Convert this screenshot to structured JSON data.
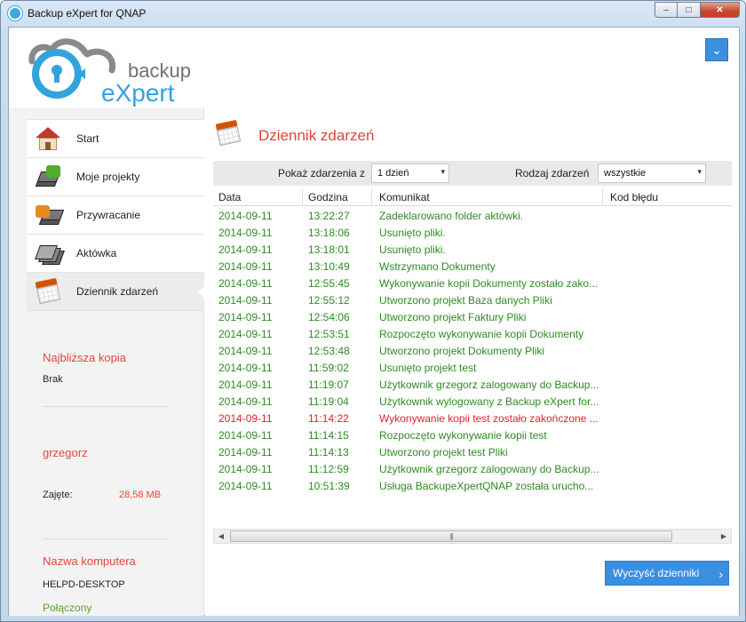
{
  "window": {
    "title": "Backup eXpert for QNAP",
    "min": "–",
    "max": "□",
    "close": "✕"
  },
  "header": {
    "logo_backup": "backup",
    "logo_expert": "eXpert",
    "menu_glyph": "⌄"
  },
  "sidebar": {
    "items": [
      {
        "label": "Start",
        "icon": "home-icon"
      },
      {
        "label": "Moje projekty",
        "icon": "projects-icon"
      },
      {
        "label": "Przywracanie",
        "icon": "restore-icon"
      },
      {
        "label": "Aktówka",
        "icon": "briefcase-icon"
      },
      {
        "label": "Dziennik zdarzeń",
        "icon": "calendar-icon",
        "active": true
      }
    ],
    "next_backup_title": "Najbliższa kopia",
    "next_backup_value": "Brak",
    "user_name": "grzegorz",
    "used_label": "Zajęte:",
    "used_value": "28,58 MB",
    "computer_title": "Nazwa komputera",
    "computer_name": "HELPD-DESKTOP",
    "status": "Połączony"
  },
  "main": {
    "title": "Dziennik zdarzeń",
    "filter": {
      "show_label": "Pokaż zdarzenia z",
      "show_value": "1 dzień",
      "type_label": "Rodzaj zdarzeń",
      "type_value": "wszystkie"
    },
    "columns": [
      "Data",
      "Godzina",
      "Komunikat",
      "Kod błędu"
    ],
    "rows": [
      {
        "date": "2014-09-11",
        "time": "13:22:27",
        "msg": "Zadeklarowano folder aktówki.",
        "code": ""
      },
      {
        "date": "2014-09-11",
        "time": "13:18:06",
        "msg": "Usunięto pliki.",
        "code": ""
      },
      {
        "date": "2014-09-11",
        "time": "13:18:01",
        "msg": "Usunięto pliki.",
        "code": ""
      },
      {
        "date": "2014-09-11",
        "time": "13:10:49",
        "msg": "Wstrzymano Dokumenty",
        "code": ""
      },
      {
        "date": "2014-09-11",
        "time": "12:55:45",
        "msg": "Wykonywanie kopii Dokumenty zostało zako...",
        "code": ""
      },
      {
        "date": "2014-09-11",
        "time": "12:55:12",
        "msg": "Utworzono projekt Baza danych Pliki",
        "code": ""
      },
      {
        "date": "2014-09-11",
        "time": "12:54:06",
        "msg": "Utworzono projekt Faktury Pliki",
        "code": ""
      },
      {
        "date": "2014-09-11",
        "time": "12:53:51",
        "msg": "Rozpoczęto wykonywanie kopii Dokumenty",
        "code": ""
      },
      {
        "date": "2014-09-11",
        "time": "12:53:48",
        "msg": "Utworzono projekt Dokumenty Pliki",
        "code": ""
      },
      {
        "date": "2014-09-11",
        "time": "11:59:02",
        "msg": "Usunięto projekt test",
        "code": ""
      },
      {
        "date": "2014-09-11",
        "time": "11:19:07",
        "msg": "Użytkownik grzegorz zalogowany do Backup...",
        "code": ""
      },
      {
        "date": "2014-09-11",
        "time": "11:19:04",
        "msg": "Użytkownik  wylogowany z Backup eXpert for...",
        "code": ""
      },
      {
        "date": "2014-09-11",
        "time": "11:14:22",
        "msg": "Wykonywanie kopii test zostało zakończone ...",
        "code": "",
        "error": true
      },
      {
        "date": "2014-09-11",
        "time": "11:14:15",
        "msg": "Rozpoczęto wykonywanie kopii test",
        "code": ""
      },
      {
        "date": "2014-09-11",
        "time": "11:14:13",
        "msg": "Utworzono projekt test Pliki",
        "code": ""
      },
      {
        "date": "2014-09-11",
        "time": "11:12:59",
        "msg": "Użytkownik grzegorz zalogowany do Backup...",
        "code": ""
      },
      {
        "date": "2014-09-11",
        "time": "10:51:39",
        "msg": "Usługa BackupeXpertQNAP została urucho...",
        "code": ""
      }
    ],
    "clear_button": "Wyczyść dzienniki"
  },
  "colors": {
    "accent": "#3b8fe0",
    "title_red": "#d9483b",
    "ok_green": "#2e8b23",
    "error_red": "#e0222a"
  }
}
